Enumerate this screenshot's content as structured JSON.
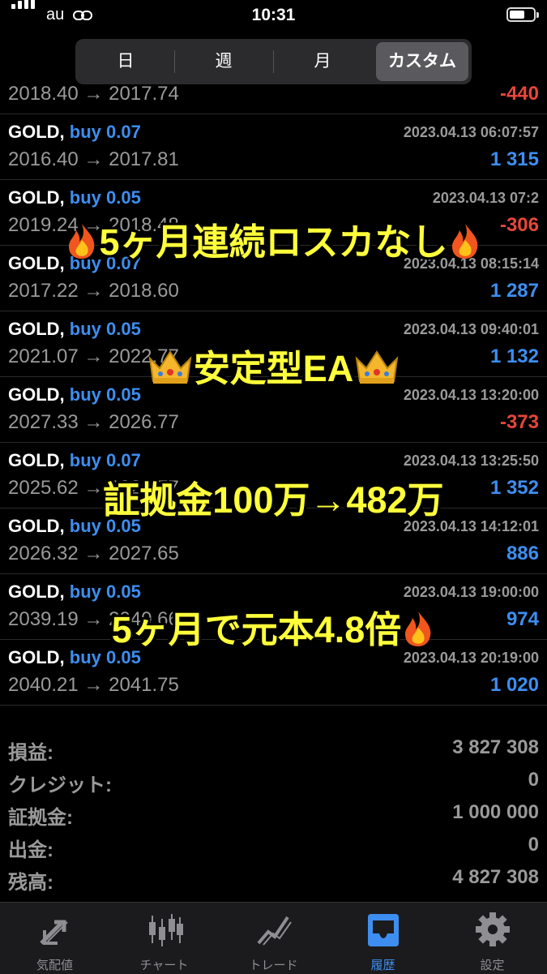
{
  "status_bar": {
    "carrier": "au",
    "time": "10:31"
  },
  "segment": {
    "tabs": [
      "日",
      "週",
      "月",
      "カスタム"
    ],
    "active": "カスタム"
  },
  "trades": [
    {
      "symbol": "",
      "side": "",
      "time": "",
      "prices": "2018.40 → 2017.74",
      "profit": "-440",
      "negative": true
    },
    {
      "symbol": "GOLD,",
      "side": "buy 0.07",
      "time": "2023.04.13 06:07:57",
      "prices": "2016.40 → 2017.81",
      "profit": "1 315",
      "negative": false
    },
    {
      "symbol": "GOLD,",
      "side": "buy 0.05",
      "time": "2023.04.13 07:2",
      "prices": "2019.24 → 2018.48",
      "profit": "-306",
      "negative": true
    },
    {
      "symbol": "GOLD,",
      "side": "buy 0.07",
      "time": "2023.04.13 08:15:14",
      "prices": "2017.22 → 2018.60",
      "profit": "1 287",
      "negative": false
    },
    {
      "symbol": "GOLD,",
      "side": "buy 0.05",
      "time": "2023.04.13 09:40:01",
      "prices": "2021.07 → 2022.77",
      "profit": "1 132",
      "negative": false
    },
    {
      "symbol": "GOLD,",
      "side": "buy 0.05",
      "time": "2023.04.13 13:20:00",
      "prices": "2027.33 → 2026.77",
      "profit": "-373",
      "negative": true
    },
    {
      "symbol": "GOLD,",
      "side": "buy 0.07",
      "time": "2023.04.13 13:25:50",
      "prices": "2025.62 → 2026.77",
      "profit": "1 352",
      "negative": false
    },
    {
      "symbol": "GOLD,",
      "side": "buy 0.05",
      "time": "2023.04.13 14:12:01",
      "prices": "2026.32 → 2027.65",
      "profit": "886",
      "negative": false
    },
    {
      "symbol": "GOLD,",
      "side": "buy 0.05",
      "time": "2023.04.13 19:00:00",
      "prices": "2039.19 → 2040.66",
      "profit": "974",
      "negative": false
    },
    {
      "symbol": "GOLD,",
      "side": "buy 0.05",
      "time": "2023.04.13 20:19:00",
      "prices": "2040.21 → 2041.75",
      "profit": "1 020",
      "negative": false
    }
  ],
  "summary": [
    {
      "label": "損益:",
      "value": "3 827 308"
    },
    {
      "label": "クレジット:",
      "value": "0"
    },
    {
      "label": "証拠金:",
      "value": "1 000 000"
    },
    {
      "label": "出金:",
      "value": "0"
    },
    {
      "label": "残高:",
      "value": "4 827 308"
    }
  ],
  "overlay": {
    "line1": "5ヶ月連続ロスカなし",
    "line2": "安定型EA",
    "line3": "証拠金100万→482万",
    "line4": "5ヶ月で元本4.8倍"
  },
  "nav": [
    "気配値",
    "チャート",
    "トレード",
    "履歴",
    "設定"
  ],
  "nav_active": "履歴",
  "colors": {
    "positive": "#3d8ef0",
    "negative": "#e8453c",
    "overlay_text": "#ffff3a"
  }
}
